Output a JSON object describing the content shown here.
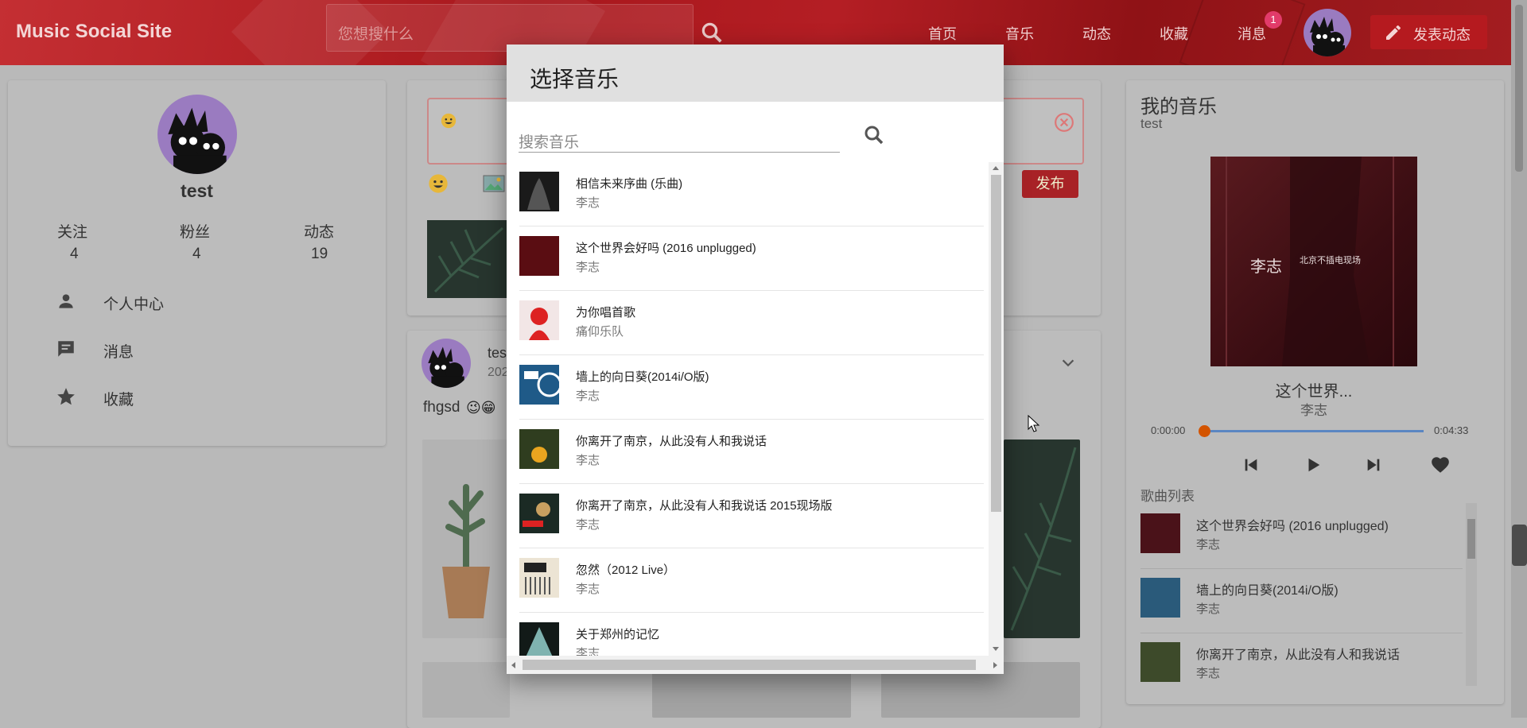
{
  "header": {
    "brand": "Music Social Site",
    "search_placeholder": "您想搜什么",
    "nav": [
      "首页",
      "音乐",
      "动态",
      "收藏",
      "消息"
    ],
    "message_badge": "1",
    "post_button": "发表动态"
  },
  "profile": {
    "name": "test",
    "stats": [
      {
        "label": "关注",
        "value": "4"
      },
      {
        "label": "粉丝",
        "value": "4"
      },
      {
        "label": "动态",
        "value": "19"
      }
    ],
    "menu": [
      {
        "label": "个人中心",
        "icon": "person-icon"
      },
      {
        "label": "消息",
        "icon": "message-icon"
      },
      {
        "label": "收藏",
        "icon": "star-icon"
      }
    ]
  },
  "composer": {
    "publish_label": "发布"
  },
  "feed": {
    "user": "test",
    "date_partial": "202",
    "text": "fhgsd"
  },
  "my_music": {
    "title": "我的音乐",
    "user": "test",
    "now_playing": {
      "title": "这个世界...",
      "artist": "李志",
      "current_time": "0:00:00",
      "total_time": "0:04:33",
      "progress": 0
    },
    "album_text": "李志",
    "album_subtext": "北京不插电现场",
    "playlist_label": "歌曲列表",
    "playlist": [
      {
        "title": "这个世界会好吗 (2016 unplugged)",
        "artist": "李志"
      },
      {
        "title": "墙上的向日葵(2014i/O版)",
        "artist": "李志"
      },
      {
        "title": "你离开了南京，从此没有人和我说话",
        "artist": "李志"
      }
    ]
  },
  "modal": {
    "title": "选择音乐",
    "search_placeholder": "搜索音乐",
    "songs": [
      {
        "title": "相信未来序曲 (乐曲)",
        "artist": "李志"
      },
      {
        "title": "这个世界会好吗 (2016 unplugged)",
        "artist": "李志"
      },
      {
        "title": "为你唱首歌",
        "artist": "痛仰乐队"
      },
      {
        "title": "墙上的向日葵(2014i/O版)",
        "artist": "李志"
      },
      {
        "title": "你离开了南京，从此没有人和我说话",
        "artist": "李志"
      },
      {
        "title": "你离开了南京，从此没有人和我说话 2015现场版",
        "artist": "李志"
      },
      {
        "title": "忽然（2012 Live）",
        "artist": "李志"
      },
      {
        "title": "关于郑州的记忆",
        "artist": "李志"
      }
    ]
  },
  "colors": {
    "header": "#b41e24",
    "accent_red": "#a82226",
    "progress": "#5b86c2",
    "knob": "#d35400",
    "avatar_purple": "#9a7bc0"
  }
}
